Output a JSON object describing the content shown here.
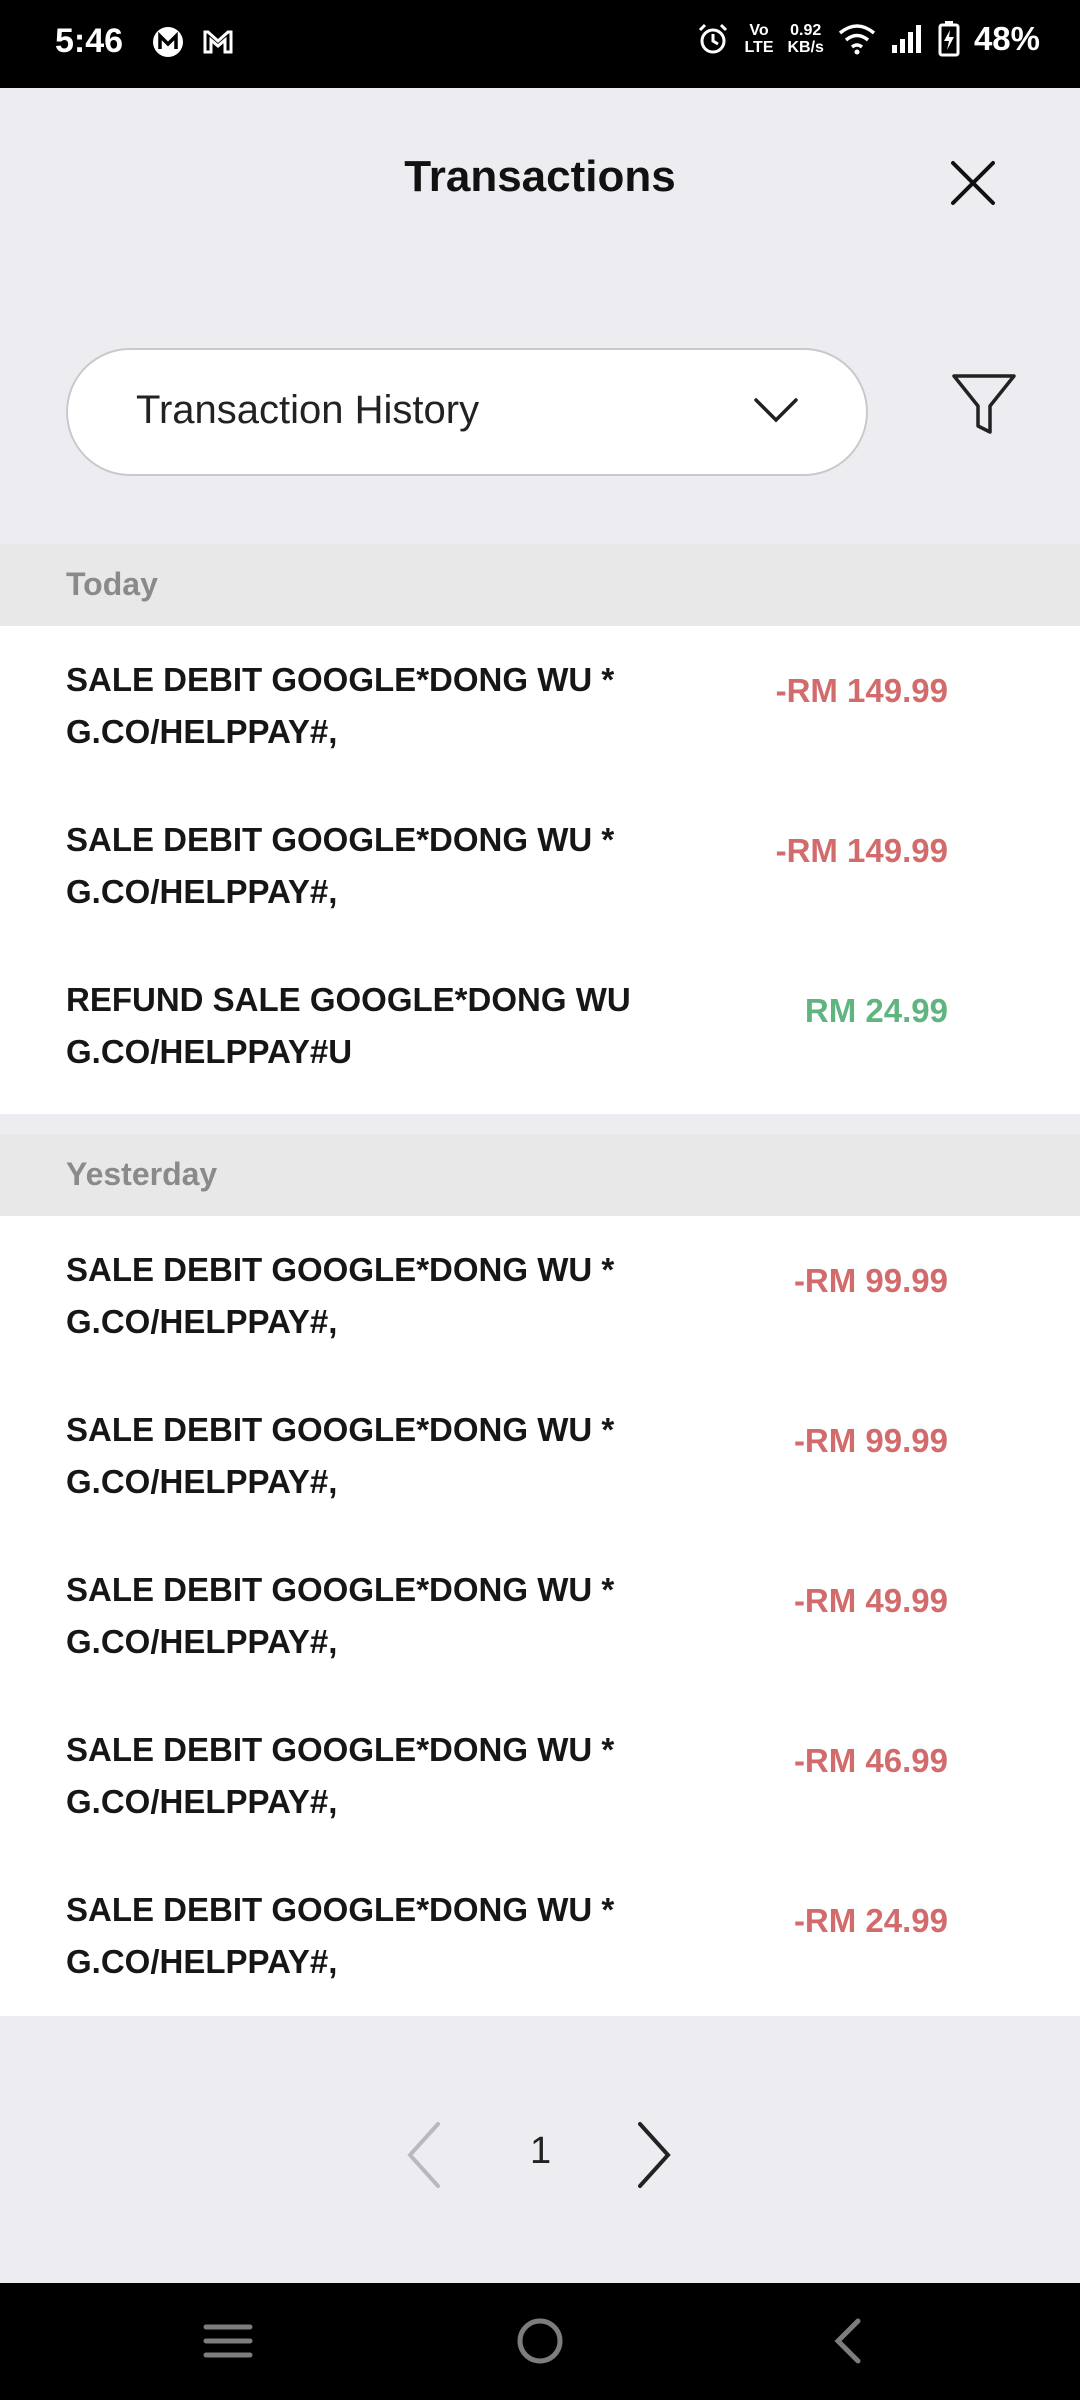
{
  "status_bar": {
    "time": "5:46",
    "net_speed_value": "0.92",
    "net_speed_unit": "KB/s",
    "volte_top": "Vo",
    "volte_bottom": "LTE",
    "battery_percent": "48%",
    "icons": [
      "m-app-icon",
      "gmail-icon",
      "alarm-icon",
      "volte-icon",
      "wifi-icon",
      "signal-icon",
      "battery-charging-icon"
    ]
  },
  "header": {
    "title": "Transactions",
    "close_icon": "close-icon"
  },
  "filter_bar": {
    "dropdown_label": "Transaction History",
    "dropdown_icon": "chevron-down-icon",
    "filter_icon": "filter-icon"
  },
  "sections": {
    "today": {
      "label": "Today",
      "items": [
        {
          "title": "SALE DEBIT GOOGLE*DONG WU *\nG.CO/HELPPAY#,",
          "amount": "-RM 149.99",
          "type": "debit"
        },
        {
          "title": "SALE DEBIT GOOGLE*DONG WU *\nG.CO/HELPPAY#,",
          "amount": "-RM 149.99",
          "type": "debit"
        },
        {
          "title": "REFUND SALE GOOGLE*DONG WU\nG.CO/HELPPAY#U",
          "amount": "RM 24.99",
          "type": "credit"
        }
      ]
    },
    "yesterday": {
      "label": "Yesterday",
      "items": [
        {
          "title": "SALE DEBIT GOOGLE*DONG WU *\nG.CO/HELPPAY#,",
          "amount": "-RM 99.99",
          "type": "debit"
        },
        {
          "title": "SALE DEBIT GOOGLE*DONG WU *\nG.CO/HELPPAY#,",
          "amount": "-RM 99.99",
          "type": "debit"
        },
        {
          "title": "SALE DEBIT GOOGLE*DONG WU *\nG.CO/HELPPAY#,",
          "amount": "-RM 49.99",
          "type": "debit"
        },
        {
          "title": "SALE DEBIT GOOGLE*DONG WU *\nG.CO/HELPPAY#,",
          "amount": "-RM 46.99",
          "type": "debit"
        },
        {
          "title": "SALE DEBIT GOOGLE*DONG WU *\nG.CO/HELPPAY#,",
          "amount": "-RM 24.99",
          "type": "debit"
        }
      ]
    }
  },
  "pagination": {
    "current_page": "1",
    "prev_icon": "chevron-left-icon",
    "next_icon": "chevron-right-icon"
  },
  "colors": {
    "debit": "#d26b6b",
    "credit": "#5fb47f",
    "background": "#edecf1"
  },
  "nav_bar": {
    "icons": [
      "recent-apps-icon",
      "home-icon",
      "back-icon"
    ]
  }
}
